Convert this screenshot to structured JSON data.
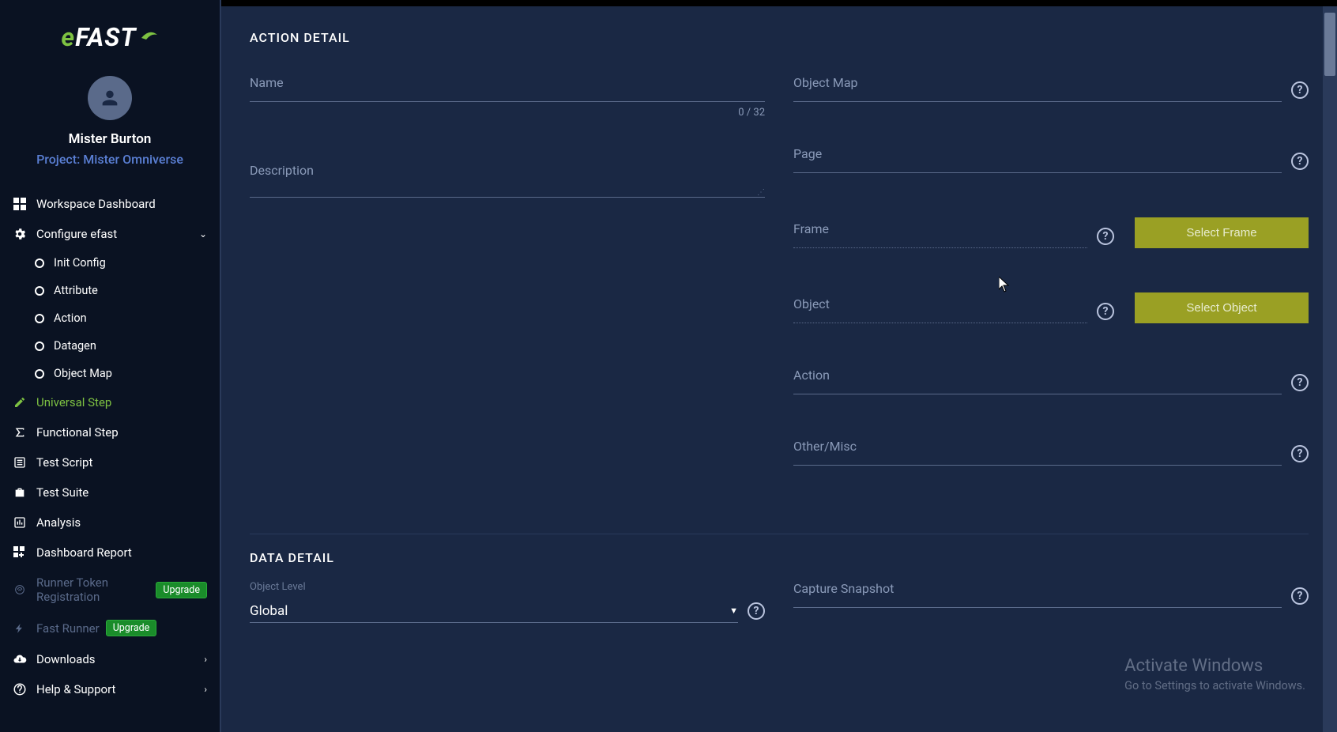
{
  "logo": {
    "prefix": "e",
    "main": "FAST"
  },
  "user": {
    "name": "Mister Burton",
    "project": "Project: Mister Omniverse"
  },
  "sidebar": {
    "items": [
      {
        "label": "Workspace Dashboard",
        "icon": "dashboard-icon"
      },
      {
        "label": "Configure efast",
        "icon": "gear-icon",
        "expanded": true,
        "children": [
          {
            "label": "Init Config"
          },
          {
            "label": "Attribute"
          },
          {
            "label": "Action"
          },
          {
            "label": "Datagen"
          },
          {
            "label": "Object Map"
          }
        ]
      },
      {
        "label": "Universal Step",
        "icon": "pencil-icon",
        "active": true
      },
      {
        "label": "Functional Step",
        "icon": "sigma-icon"
      },
      {
        "label": "Test Script",
        "icon": "list-icon"
      },
      {
        "label": "Test Suite",
        "icon": "briefcase-icon"
      },
      {
        "label": "Analysis",
        "icon": "chart-icon"
      },
      {
        "label": "Dashboard Report",
        "icon": "grid-plus-icon"
      },
      {
        "label": "Runner Token Registration",
        "icon": "fingerprint-icon",
        "badge": "Upgrade",
        "disabled": true
      },
      {
        "label": "Fast Runner",
        "icon": "bolt-icon",
        "badge": "Upgrade",
        "disabled": true
      },
      {
        "label": "Downloads",
        "icon": "cloud-down-icon",
        "chevron": true
      },
      {
        "label": "Help & Support",
        "icon": "help-icon",
        "chevron": true
      }
    ]
  },
  "sections": {
    "action_detail": "ACTION DETAIL",
    "data_detail": "DATA DETAIL"
  },
  "fields": {
    "name": {
      "label": "Name",
      "counter": "0 / 32"
    },
    "description": {
      "label": "Description"
    },
    "object_map": {
      "label": "Object Map"
    },
    "page": {
      "label": "Page"
    },
    "frame": {
      "label": "Frame",
      "button": "Select Frame"
    },
    "object": {
      "label": "Object",
      "button": "Select Object"
    },
    "action": {
      "label": "Action"
    },
    "other_misc": {
      "label": "Other/Misc"
    },
    "object_level": {
      "label": "Object Level",
      "value": "Global"
    },
    "capture_snapshot": {
      "label": "Capture Snapshot"
    }
  },
  "watermark": {
    "title": "Activate Windows",
    "subtitle": "Go to Settings to activate Windows."
  }
}
